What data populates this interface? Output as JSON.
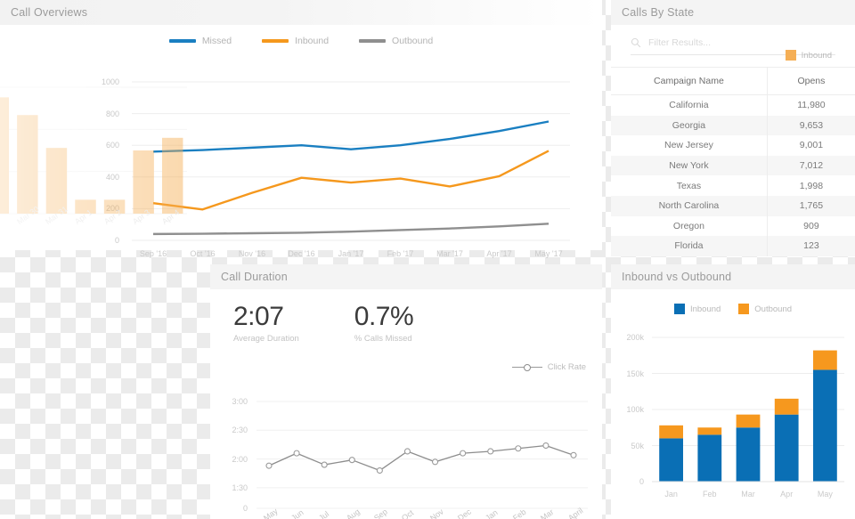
{
  "colors": {
    "blue": "#1277bd",
    "orange": "#f5981d",
    "gray": "#8f8f8f",
    "faded_orange": "#f5ae54"
  },
  "panels": {
    "call_overviews": {
      "title": "Call Overviews",
      "legend": [
        {
          "label": "Missed",
          "color": "#1a7fc1"
        },
        {
          "label": "Inbound",
          "color": "#f5981d"
        },
        {
          "label": "Outbound",
          "color": "#8f8f8f"
        }
      ]
    },
    "calls_by_state": {
      "title": "Calls By State",
      "search_placeholder": "Filter Results...",
      "search_value": "",
      "search_icon": "search-icon",
      "columns": [
        "Campaign Name",
        "Opens"
      ],
      "rows": [
        {
          "name": "California",
          "opens": "11,980"
        },
        {
          "name": "Georgia",
          "opens": "9,653"
        },
        {
          "name": "New Jersey",
          "opens": "9,001"
        },
        {
          "name": "New York",
          "opens": "7,012"
        },
        {
          "name": "Texas",
          "opens": "1,998"
        },
        {
          "name": "North Carolina",
          "opens": "1,765"
        },
        {
          "name": "Oregon",
          "opens": "909"
        },
        {
          "name": "Florida",
          "opens": "123"
        }
      ]
    },
    "call_duration": {
      "title": "Call Duration",
      "kpis": [
        {
          "value": "2:07",
          "label": "Average Duration"
        },
        {
          "value": "0.7%",
          "label": "% Calls Missed"
        }
      ],
      "legend_label": "Click Rate"
    },
    "inbound_vs_outbound": {
      "title": "Inbound vs Outbound",
      "legend": [
        {
          "label": "Inbound",
          "color": "#0a6fb5"
        },
        {
          "label": "Outbound",
          "color": "#f6981e"
        }
      ]
    },
    "faded_inbound": {
      "legend": [
        {
          "label": "Inbound",
          "color": "#f5ae54"
        }
      ]
    }
  },
  "chart_data": [
    {
      "id": "call-overviews",
      "type": "line",
      "title": "Call Overviews",
      "xlabel": "",
      "ylabel": "",
      "categories": [
        "Sep '16",
        "Oct '16",
        "Nov '16",
        "Dec '16",
        "Jan '17",
        "Feb '17",
        "Mar '17",
        "Apr '17",
        "May '17"
      ],
      "yticks": [
        "0",
        "200",
        "400",
        "600",
        "800",
        "1000"
      ],
      "ylim": [
        0,
        1000
      ],
      "grid": true,
      "legend_position": "top-center",
      "series": [
        {
          "name": "Missed",
          "color": "#1a7fc1",
          "values": [
            560,
            570,
            585,
            600,
            575,
            600,
            640,
            690,
            750
          ]
        },
        {
          "name": "Inbound",
          "color": "#f5981d",
          "values": [
            235,
            195,
            300,
            395,
            365,
            390,
            340,
            405,
            565
          ]
        },
        {
          "name": "Outbound",
          "color": "#8f8f8f",
          "values": [
            40,
            42,
            45,
            48,
            55,
            65,
            75,
            88,
            105
          ]
        }
      ]
    },
    {
      "id": "call-duration",
      "type": "line",
      "title": "Call Duration",
      "categories": [
        "May",
        "Jun",
        "Jul",
        "Aug",
        "Sep",
        "Oct",
        "Nov",
        "Dec",
        "Jan",
        "Feb",
        "Mar",
        "April"
      ],
      "yticks": [
        "0",
        "1:30",
        "2:00",
        "2:30",
        "3:00"
      ],
      "ylim": [
        0,
        180
      ],
      "grid": true,
      "legend_position": "top-right",
      "series": [
        {
          "name": "Click Rate",
          "color": "#8d8d8d",
          "values": [
            113,
            126,
            114,
            119,
            108,
            128,
            117,
            126,
            128,
            131,
            134,
            124
          ]
        }
      ]
    },
    {
      "id": "inbound-vs-outbound",
      "type": "bar",
      "title": "Inbound vs Outbound",
      "stacked": true,
      "categories": [
        "Jan",
        "Feb",
        "Mar",
        "Apr",
        "May"
      ],
      "yticks": [
        "0",
        "50k",
        "100k",
        "150k",
        "200k"
      ],
      "ylim": [
        0,
        200000
      ],
      "grid": true,
      "legend_position": "top-center",
      "series": [
        {
          "name": "Inbound",
          "color": "#0a6fb5",
          "values": [
            60000,
            65000,
            75000,
            93000,
            155000
          ]
        },
        {
          "name": "Outbound",
          "color": "#f6981e",
          "values": [
            18000,
            10000,
            18000,
            22000,
            27000
          ]
        }
      ]
    },
    {
      "id": "faded-inbound",
      "type": "bar",
      "title": "",
      "categories": [
        "Mar 30",
        "Mar 31",
        "Apr 1",
        "Apr 2",
        "Apr 3",
        "Apr 4"
      ],
      "grid": true,
      "legend_position": "top-right",
      "series": [
        {
          "name": "Inbound",
          "color": "#f5ae54",
          "values": [
            92,
            78,
            52,
            11,
            11,
            50,
            60
          ]
        }
      ]
    }
  ]
}
